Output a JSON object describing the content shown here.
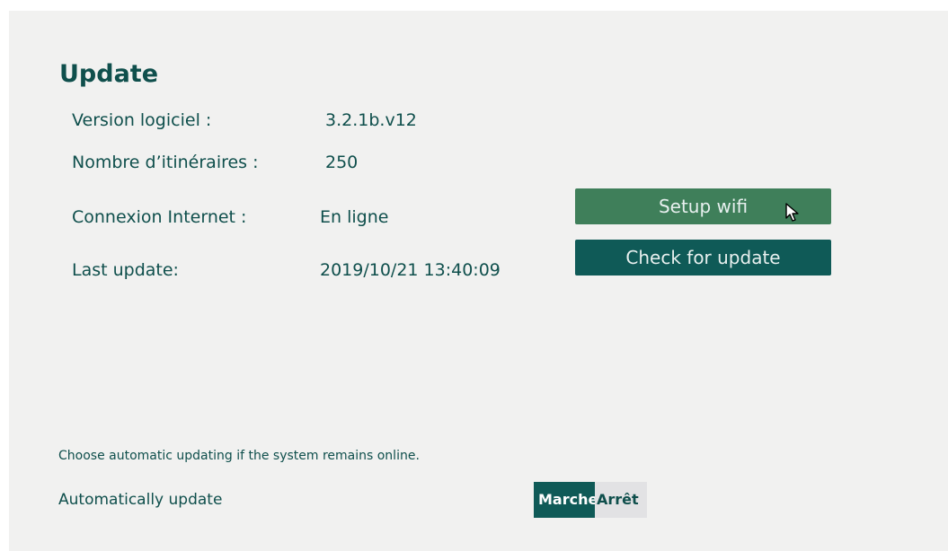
{
  "title": "Update",
  "info": {
    "version_label": "Version logiciel :",
    "version_value": "3.2.1b.v12",
    "routes_label": "Nombre d’itinéraires :",
    "routes_value": "250",
    "connection_label": "Connexion Internet :",
    "connection_value": "En ligne",
    "last_update_label": "Last update:",
    "last_update_value": "2019/10/21 13:40:09"
  },
  "buttons": {
    "setup_wifi": "Setup wifi",
    "check_update": "Check for update"
  },
  "auto_update": {
    "hint": "Choose automatic updating if the system remains online.",
    "label": "Automatically update",
    "on_label": "Marche",
    "off_label": "Arrêt",
    "selected": "Marche"
  },
  "colors": {
    "text": "#0f4f4c",
    "wifi_button": "#3f7f5a",
    "update_button": "#0f5a57",
    "panel_bg": "#f1f1f0"
  },
  "icons": {
    "cursor": "mouse-pointer-icon"
  }
}
